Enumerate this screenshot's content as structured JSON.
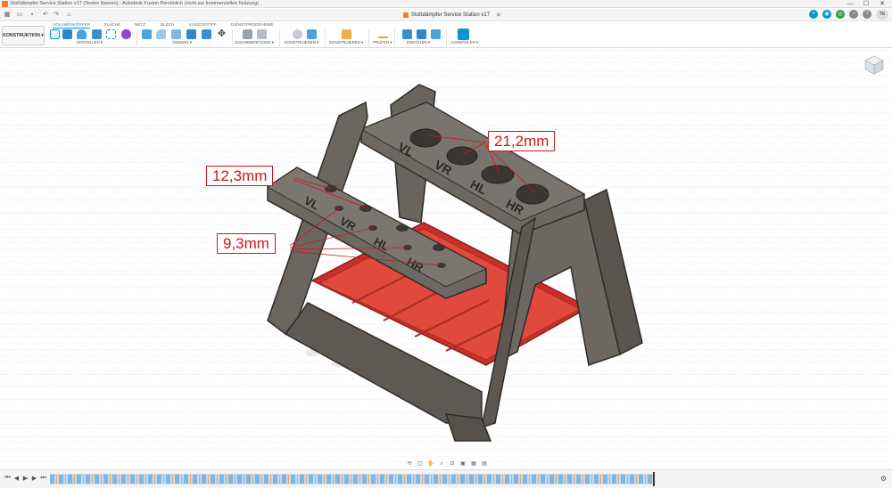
{
  "window": {
    "title": "Stoßdämpfer Service Station v17 (Testen Namen) - Autodesk Fusion Persönlich (nicht zur kommerziellen Nutzung)",
    "controls": {
      "minimize": "—",
      "maximize": "☐",
      "close": "✕"
    }
  },
  "document_tab": {
    "label": "Stoßdämpfer Service Station v17",
    "close": "✕"
  },
  "user": {
    "initials": "TE"
  },
  "workspace": {
    "label": "KONSTRUKTION ▾"
  },
  "ribbon": {
    "tabs": [
      "VOLUMENKÖRPER",
      "FLÄCHE",
      "NETZ",
      "BLECH",
      "KUNSTSTOFF",
      "DIENSTPROGRAMME"
    ],
    "active_tab": 0,
    "groups": [
      "ERSTELLEN ▾",
      "ÄNDERN ▾",
      "ZUSAMMENFÜGEN ▾",
      "KONSTRUIEREN ▾",
      "KONSTRUIEREN ▾",
      "PRÜFEN ▾",
      "EINFÜGEN ▾",
      "AUSWÄHLEN ▾"
    ]
  },
  "dimensions": {
    "top_holes": "21,2mm",
    "front_width": "12,3mm",
    "front_holes": "9,3mm"
  },
  "engravings": {
    "top": [
      "VL",
      "VR",
      "HL",
      "HR"
    ],
    "front": [
      "VL",
      "VR",
      "HL",
      "HR"
    ]
  },
  "colors": {
    "accent": "#0696d7",
    "dimension": "#d01616",
    "frame": "#5f5a55",
    "tray": "#d9382c",
    "brand": "#f47b20"
  },
  "timeline": {
    "controls": [
      "⏮",
      "◀",
      "▶",
      "▶",
      "⏭"
    ]
  }
}
